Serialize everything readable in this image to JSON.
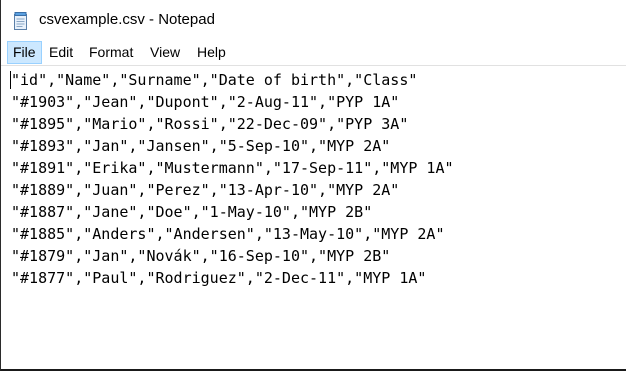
{
  "window": {
    "title": "csvexample.csv - Notepad",
    "icon": "notepad-icon"
  },
  "menu": {
    "items": [
      {
        "label": "File",
        "active": true
      },
      {
        "label": "Edit",
        "active": false
      },
      {
        "label": "Format",
        "active": false
      },
      {
        "label": "View",
        "active": false
      },
      {
        "label": "Help",
        "active": false
      }
    ]
  },
  "editor": {
    "lines": [
      "\"id\",\"Name\",\"Surname\",\"Date of birth\",\"Class\"",
      "\"#1903\",\"Jean\",\"Dupont\",\"2-Aug-11\",\"PYP 1A\"",
      "\"#1895\",\"Mario\",\"Rossi\",\"22-Dec-09\",\"PYP 3A\"",
      "\"#1893\",\"Jan\",\"Jansen\",\"5-Sep-10\",\"MYP 2A\"",
      "\"#1891\",\"Erika\",\"Mustermann\",\"17-Sep-11\",\"MYP 1A\"",
      "\"#1889\",\"Juan\",\"Perez\",\"13-Apr-10\",\"MYP 2A\"",
      "\"#1887\",\"Jane\",\"Doe\",\"1-May-10\",\"MYP 2B\"",
      "\"#1885\",\"Anders\",\"Andersen\",\"13-May-10\",\"MYP 2A\"",
      "\"#1879\",\"Jan\",\"Novák\",\"16-Sep-10\",\"MYP 2B\"",
      "\"#1877\",\"Paul\",\"Rodriguez\",\"2-Dec-11\",\"MYP 1A\""
    ]
  }
}
